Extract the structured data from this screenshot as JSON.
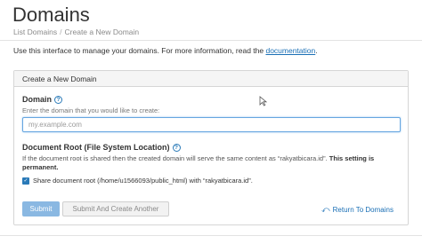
{
  "page": {
    "title": "Domains",
    "breadcrumb": [
      "List Domains",
      "Create a New Domain"
    ],
    "breadcrumb_separator": "/"
  },
  "intro": {
    "text": "Use this interface to manage your domains. For more information, read the ",
    "link_label": "documentation",
    "suffix": "."
  },
  "panel": {
    "heading": "Create a New Domain",
    "domain": {
      "label": "Domain",
      "hint": "Enter the domain that you would like to create:",
      "placeholder": "my.example.com",
      "value": ""
    },
    "document_root": {
      "label": "Document Root (File System Location)",
      "description": "If the document root is shared then the created domain will serve the same content as “rakyatbicara.id”.",
      "description_bold": "This setting is permanent.",
      "share_label": "Share document root (/home/u1566093/public_html) with “rakyatbicara.id”.",
      "share_checked": true
    },
    "buttons": {
      "submit": "Submit",
      "submit_create": "Submit And Create Another",
      "return": "Return To Domains"
    }
  },
  "icons": {
    "help": "question-circle-icon",
    "return": "return-arrow-icon",
    "checkbox": "checkbox-checked-icon"
  },
  "colors": {
    "link": "#1a6fb5",
    "submit_bg": "#8ab8e2",
    "panel_header_bg": "#f5f5f5"
  }
}
